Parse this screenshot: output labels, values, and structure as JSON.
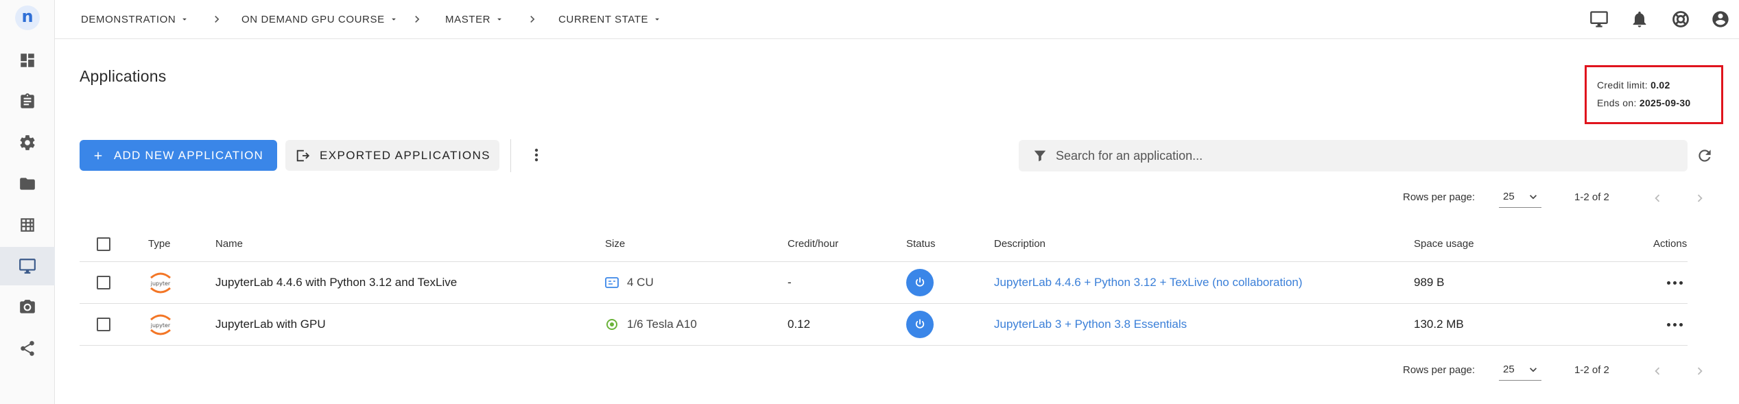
{
  "app": {
    "logo_letter": "n"
  },
  "breadcrumbs": [
    {
      "label": "DEMONSTRATION"
    },
    {
      "label": "ON DEMAND GPU COURSE"
    },
    {
      "label": "MASTER"
    },
    {
      "label": "CURRENT STATE"
    }
  ],
  "sidebar": {
    "items": [
      {
        "icon": "dashboard-icon"
      },
      {
        "icon": "clipboard-icon"
      },
      {
        "icon": "gear-icon"
      },
      {
        "icon": "folder-icon"
      },
      {
        "icon": "table-icon"
      },
      {
        "icon": "monitor-icon",
        "active": true
      },
      {
        "icon": "camera-icon"
      },
      {
        "icon": "share-icon"
      }
    ]
  },
  "topbar_icons": [
    "monitor-icon",
    "bell-icon",
    "help-lifebuoy-icon",
    "account-icon"
  ],
  "page": {
    "title": "Applications"
  },
  "credit": {
    "limit_label": "Credit limit:",
    "limit_value": "0.02",
    "ends_label": "Ends on:",
    "ends_value": "2025-09-30",
    "highlight_color": "#e0141d"
  },
  "toolbar": {
    "add_label": "ADD NEW APPLICATION",
    "exported_label": "EXPORTED APPLICATIONS",
    "search_placeholder": "Search for an application..."
  },
  "pagination": {
    "rows_per_page_label": "Rows per page:",
    "rows_per_page_value": "25",
    "range_label": "1-2 of 2"
  },
  "table": {
    "headers": {
      "type": "Type",
      "name": "Name",
      "size": "Size",
      "credit": "Credit/hour",
      "status": "Status",
      "description": "Description",
      "space": "Space usage",
      "actions": "Actions"
    },
    "rows": [
      {
        "type": "jupyter",
        "name": "JupyterLab 4.4.6 with Python 3.12 and TexLive",
        "size": "4 CU",
        "size_icon": "cpu-chip-icon",
        "credit": "-",
        "description": "JupyterLab 4.4.6 + Python 3.12 + TexLive (no collaboration)",
        "space": "989 B"
      },
      {
        "type": "jupyter",
        "name": "JupyterLab with GPU",
        "size": "1/6 Tesla A10",
        "size_icon": "gpu-icon",
        "credit": "0.12",
        "description": "JupyterLab 3 + Python 3.8 Essentials",
        "space": "130.2 MB"
      }
    ]
  },
  "colors": {
    "accent": "#3a86e8",
    "link": "#3a7fd8"
  }
}
